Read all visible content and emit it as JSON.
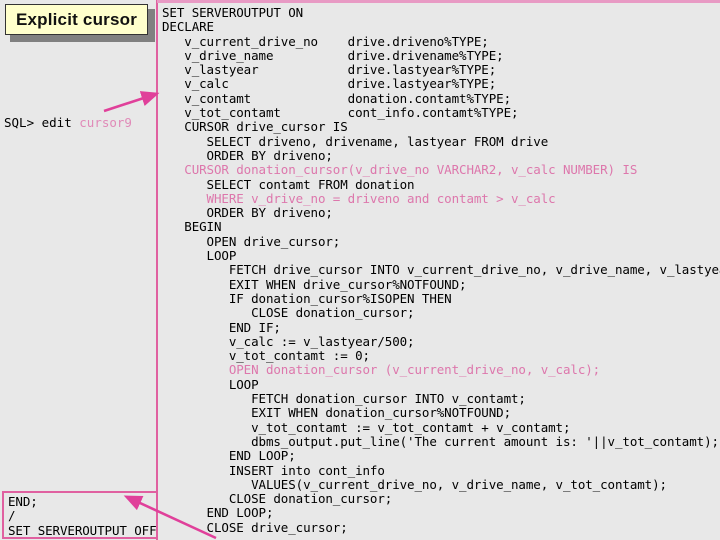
{
  "slide": {
    "background_color": "#e8e8e8",
    "accent_color": "#e060a0",
    "highlight_color": "#dd77ac"
  },
  "callout": {
    "title": "Explicit cursor",
    "box_fill": "#ffffcc",
    "shadow_color": "#808080"
  },
  "prompt": {
    "command": "SQL> edit ",
    "filename": "cursor9"
  },
  "end_box": {
    "lines": [
      "END;",
      "/",
      "SET SERVEROUTPUT OFF"
    ]
  },
  "code": {
    "lines": [
      {
        "text": "SET SERVEROUTPUT ON",
        "highlight": false
      },
      {
        "text": "DECLARE",
        "highlight": false
      },
      {
        "text": "   v_current_drive_no    drive.driveno%TYPE;",
        "highlight": false
      },
      {
        "text": "   v_drive_name          drive.drivename%TYPE;",
        "highlight": false
      },
      {
        "text": "   v_lastyear            drive.lastyear%TYPE;",
        "highlight": false
      },
      {
        "text": "   v_calc                drive.lastyear%TYPE;",
        "highlight": false
      },
      {
        "text": "   v_contamt             donation.contamt%TYPE;",
        "highlight": false
      },
      {
        "text": "   v_tot_contamt         cont_info.contamt%TYPE;",
        "highlight": false
      },
      {
        "text": "   CURSOR drive_cursor IS",
        "highlight": false
      },
      {
        "text": "      SELECT driveno, drivename, lastyear FROM drive",
        "highlight": false
      },
      {
        "text": "      ORDER BY driveno;",
        "highlight": false
      },
      {
        "text": "   CURSOR donation_cursor(v_drive_no VARCHAR2, v_calc NUMBER) IS",
        "highlight": true
      },
      {
        "text": "      SELECT contamt FROM donation",
        "highlight": false
      },
      {
        "text": "      WHERE v_drive_no = driveno and contamt > v_calc",
        "highlight": true
      },
      {
        "text": "      ORDER BY driveno;",
        "highlight": false
      },
      {
        "text": "   BEGIN",
        "highlight": false
      },
      {
        "text": "      OPEN drive_cursor;",
        "highlight": false
      },
      {
        "text": "      LOOP",
        "highlight": false
      },
      {
        "text": "         FETCH drive_cursor INTO v_current_drive_no, v_drive_name, v_lastyear;",
        "highlight": false
      },
      {
        "text": "         EXIT WHEN drive_cursor%NOTFOUND;",
        "highlight": false
      },
      {
        "text": "         IF donation_cursor%ISOPEN THEN",
        "highlight": false
      },
      {
        "text": "            CLOSE donation_cursor;",
        "highlight": false
      },
      {
        "text": "         END IF;",
        "highlight": false
      },
      {
        "text": "         v_calc := v_lastyear/500;",
        "highlight": false
      },
      {
        "text": "         v_tot_contamt := 0;",
        "highlight": false
      },
      {
        "text": "         OPEN donation_cursor (v_current_drive_no, v_calc);",
        "highlight": true
      },
      {
        "text": "         LOOP",
        "highlight": false
      },
      {
        "text": "            FETCH donation_cursor INTO v_contamt;",
        "highlight": false
      },
      {
        "text": "            EXIT WHEN donation_cursor%NOTFOUND;",
        "highlight": false
      },
      {
        "text": "            v_tot_contamt := v_tot_contamt + v_contamt;",
        "highlight": false
      },
      {
        "text": "            dbms_output.put_line('The current amount is: '||v_tot_contamt);",
        "highlight": false
      },
      {
        "text": "         END LOOP;",
        "highlight": false
      },
      {
        "text": "         INSERT into cont_info",
        "highlight": false
      },
      {
        "text": "            VALUES(v_current_drive_no, v_drive_name, v_tot_contamt);",
        "highlight": false
      },
      {
        "text": "         CLOSE donation_cursor;",
        "highlight": false
      },
      {
        "text": "      END LOOP;",
        "highlight": false
      },
      {
        "text": "      CLOSE drive_cursor;",
        "highlight": false
      }
    ]
  }
}
